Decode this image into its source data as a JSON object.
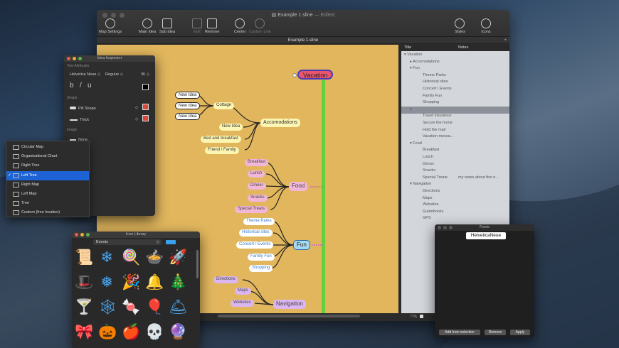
{
  "main_window": {
    "title": "Example 1.sline",
    "edited": "— Edited",
    "toolbar": {
      "map_settings": "Map Settings",
      "main_idea": "Main Idea",
      "sub_idea": "Sub Idea",
      "edit": "Edit",
      "remove": "Remove",
      "center": "Center",
      "custom_link": "Custom Link",
      "styles": "Styles",
      "icons": "Icons"
    },
    "tab_title": "Example 1.sline",
    "zoom": "77%"
  },
  "mindmap": {
    "root": "Vacation",
    "accomodations": {
      "label": "Accomodations",
      "cottage": "Cottage",
      "cottage_children": [
        "New Idea",
        "New Idea",
        "New Idea"
      ],
      "children": [
        "New Idea",
        "Bed and breakfast",
        "Friend / Family"
      ]
    },
    "food": {
      "label": "Food",
      "children": [
        "Breakfast",
        "Lunch",
        "Dinner",
        "Snacks",
        "Special Treats"
      ]
    },
    "fun": {
      "label": "Fun",
      "children": [
        "Theme Parks",
        "Historical sites",
        "Concert / Events",
        "Family Fun",
        "Shopping"
      ]
    },
    "navigation": {
      "label": "Navigation",
      "children": [
        "Directions",
        "Maps",
        "Websites"
      ]
    }
  },
  "outline": {
    "col_title": "Title",
    "col_notes": "Notes",
    "rows": [
      {
        "text": "▾ Vacation",
        "indent": 0
      },
      {
        "text": "▸ Accomodations",
        "indent": 1
      },
      {
        "text": "▾ Fun",
        "indent": 1
      },
      {
        "text": "Theme Parks",
        "indent": 2
      },
      {
        "text": "Historical sites",
        "indent": 2
      },
      {
        "text": "Concert / Events",
        "indent": 2
      },
      {
        "text": "Family Fun",
        "indent": 2
      },
      {
        "text": "Shopping",
        "indent": 2
      },
      {
        "text": "▾",
        "indent": 1,
        "selected": true
      },
      {
        "text": "Travel insurance",
        "indent": 2
      },
      {
        "text": "Secure the home",
        "indent": 2
      },
      {
        "text": "Hold the mail",
        "indent": 2
      },
      {
        "text": "Vacation messa...",
        "indent": 2
      },
      {
        "text": "▾ Food",
        "indent": 1
      },
      {
        "text": "Breakfast",
        "indent": 2
      },
      {
        "text": "Lunch",
        "indent": 2
      },
      {
        "text": "Dinner",
        "indent": 2
      },
      {
        "text": "Snacks",
        "indent": 2
      },
      {
        "text": "Special Treats",
        "indent": 2,
        "note": "my notes about this n..."
      },
      {
        "text": "▾ Navigation",
        "indent": 1
      },
      {
        "text": "Directions",
        "indent": 2
      },
      {
        "text": "Maps",
        "indent": 2
      },
      {
        "text": "Websites",
        "indent": 2
      },
      {
        "text": "Guidebooks",
        "indent": 2
      },
      {
        "text": "GPS",
        "indent": 2
      }
    ]
  },
  "inspector": {
    "title": "Idea Inspector",
    "text_attributes": "Text Attributes",
    "font_family": "Helvetica Neue",
    "font_style": "Regular",
    "font_size": "36",
    "bold": "b",
    "italic": "/",
    "underline": "u",
    "shape_section": "Shape",
    "shape": "Pill Shape",
    "line": "Thick",
    "image_section": "Image",
    "image": "None",
    "layout_options": [
      "Circular Map",
      "Organizational Chart",
      "Right Tree",
      "Left Tree",
      "Right Map",
      "Left Map",
      "Tree",
      "Custom (free location)"
    ],
    "selected_layout": "Left Tree",
    "check": "✓",
    "colors": {
      "text": "#000000",
      "shape": "#e0473b"
    }
  },
  "icon_library": {
    "title": "Icon Library",
    "category": "Events",
    "color": "#39a0ea",
    "icons": [
      {
        "name": "scroll-icon",
        "glyph": "📜"
      },
      {
        "name": "snowflake-icon",
        "glyph": "❄"
      },
      {
        "name": "lollipop-icon",
        "glyph": "🍭"
      },
      {
        "name": "cauldron-icon",
        "glyph": "🍲"
      },
      {
        "name": "firework-icon",
        "glyph": "🚀"
      },
      {
        "name": "witch-hat-icon",
        "glyph": "🎩"
      },
      {
        "name": "snowflake-2-icon",
        "glyph": "❅"
      },
      {
        "name": "party-hat-icon",
        "glyph": "🎉"
      },
      {
        "name": "bell-icon",
        "glyph": "🔔"
      },
      {
        "name": "christmas-tree-icon",
        "glyph": "🎄"
      },
      {
        "name": "cocktail-icon",
        "glyph": "🍸"
      },
      {
        "name": "spiderweb-icon",
        "glyph": "🕸"
      },
      {
        "name": "candy-cane-icon",
        "glyph": "🍬"
      },
      {
        "name": "balloon-icon",
        "glyph": "🎈"
      },
      {
        "name": "bells-icon",
        "glyph": "🛎"
      },
      {
        "name": "bow-icon",
        "glyph": "🎀"
      },
      {
        "name": "pumpkin-icon",
        "glyph": "🎃"
      },
      {
        "name": "ornament-icon",
        "glyph": "🍎"
      },
      {
        "name": "skull-icon",
        "glyph": "💀"
      },
      {
        "name": "snowglobe-icon",
        "glyph": "🔮"
      }
    ]
  },
  "fonts_panel": {
    "title": "Fonts",
    "preview": "HelveticaNeue",
    "add_button": "Add from selection",
    "remove_button": "Remove",
    "apply_button": "Apply"
  },
  "colors": {
    "canvas": "#e1b65d",
    "root_node": "#e8566b",
    "trunk": "#5fd13c",
    "accent_blue": "#1e63d5"
  }
}
